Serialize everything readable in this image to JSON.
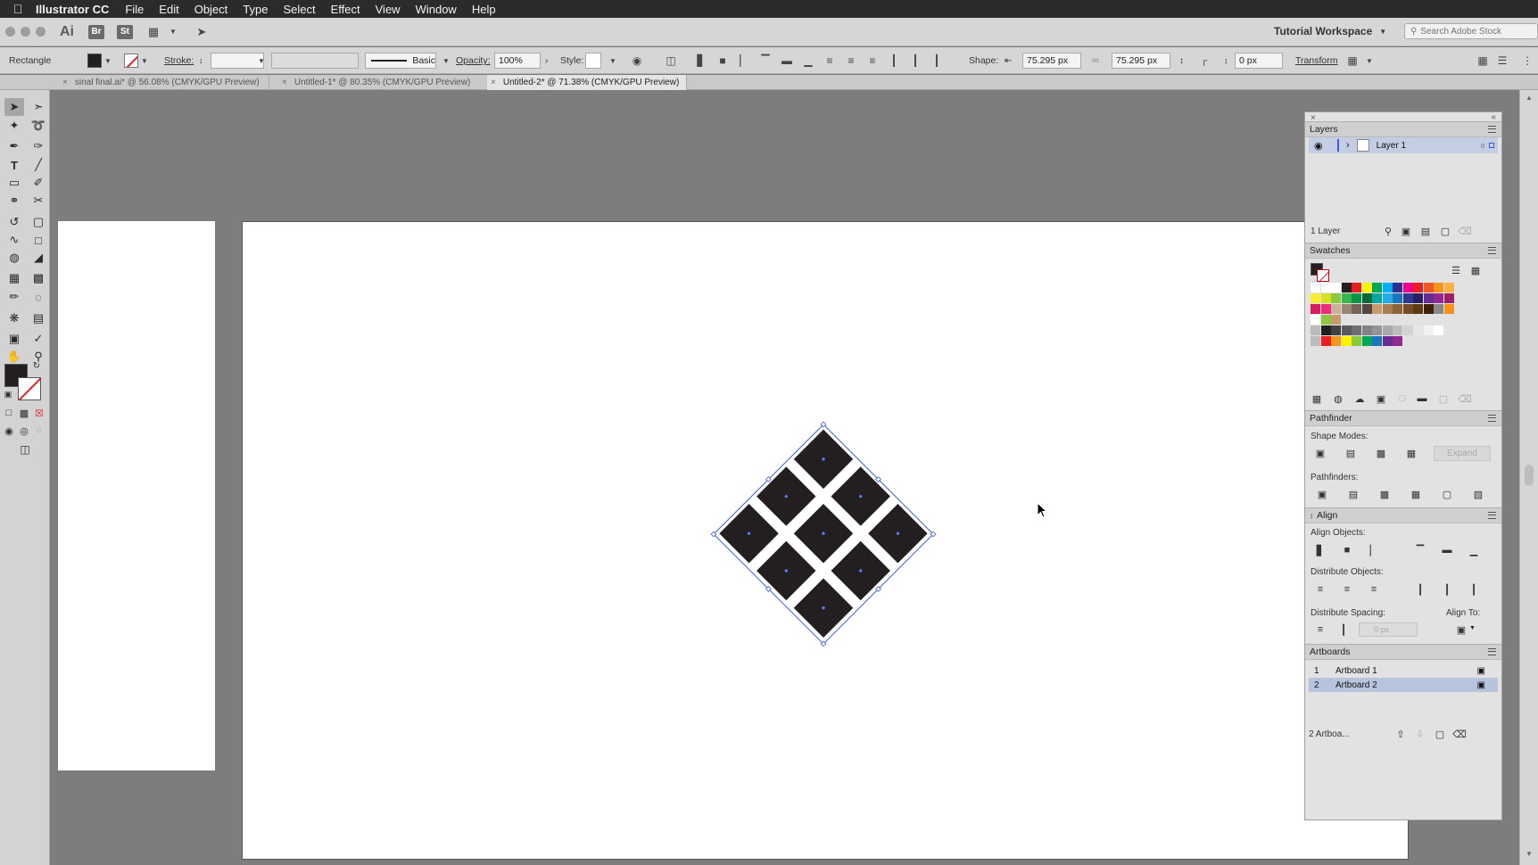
{
  "menubar": {
    "app_name": "Illustrator CC",
    "items": [
      "File",
      "Edit",
      "Object",
      "Type",
      "Select",
      "Effect",
      "View",
      "Window",
      "Help"
    ]
  },
  "appbar": {
    "logo": "Ai",
    "bridge_label": "Br",
    "stock_label": "St",
    "workspace": "Tutorial Workspace",
    "search_placeholder": "Search Adobe Stock"
  },
  "control": {
    "selection_type": "Rectangle",
    "stroke_label": "Stroke:",
    "stroke_profile": "Basic",
    "opacity_label": "Opacity:",
    "opacity_value": "100%",
    "style_label": "Style:",
    "shape_label": "Shape:",
    "width_value": "75.295 px",
    "height_value": "75.295 px",
    "corner_value": "0 px",
    "transform_label": "Transform"
  },
  "tabs": [
    {
      "label": "sinal final.ai* @ 56.08% (CMYK/GPU Preview)",
      "active": false
    },
    {
      "label": "Untitled-1* @ 80.35% (CMYK/GPU Preview)",
      "active": false
    },
    {
      "label": "Untitled-2* @ 71.38% (CMYK/GPU Preview)",
      "active": true
    }
  ],
  "layers": {
    "title": "Layers",
    "layer_name": "Layer 1",
    "count": "1 Layer"
  },
  "swatches": {
    "title": "Swatches"
  },
  "pathfinder": {
    "title": "Pathfinder",
    "shape_modes": "Shape Modes:",
    "expand": "Expand",
    "pathfinders": "Pathfinders:"
  },
  "align": {
    "title": "Align",
    "align_objects": "Align Objects:",
    "distribute_objects": "Distribute Objects:",
    "distribute_spacing": "Distribute Spacing:",
    "spacing_value": "0 px",
    "align_to": "Align To:"
  },
  "artboards": {
    "title": "Artboards",
    "items": [
      {
        "num": "1",
        "name": "Artboard 1",
        "selected": false
      },
      {
        "num": "2",
        "name": "Artboard 2",
        "selected": true
      }
    ],
    "count": "2 Artboa..."
  },
  "colors": {
    "menubar_bg": "#2b2b2b",
    "fill": "#231f20",
    "selection": "#3b5bd6",
    "layer_highlight": "#c3cde3"
  }
}
